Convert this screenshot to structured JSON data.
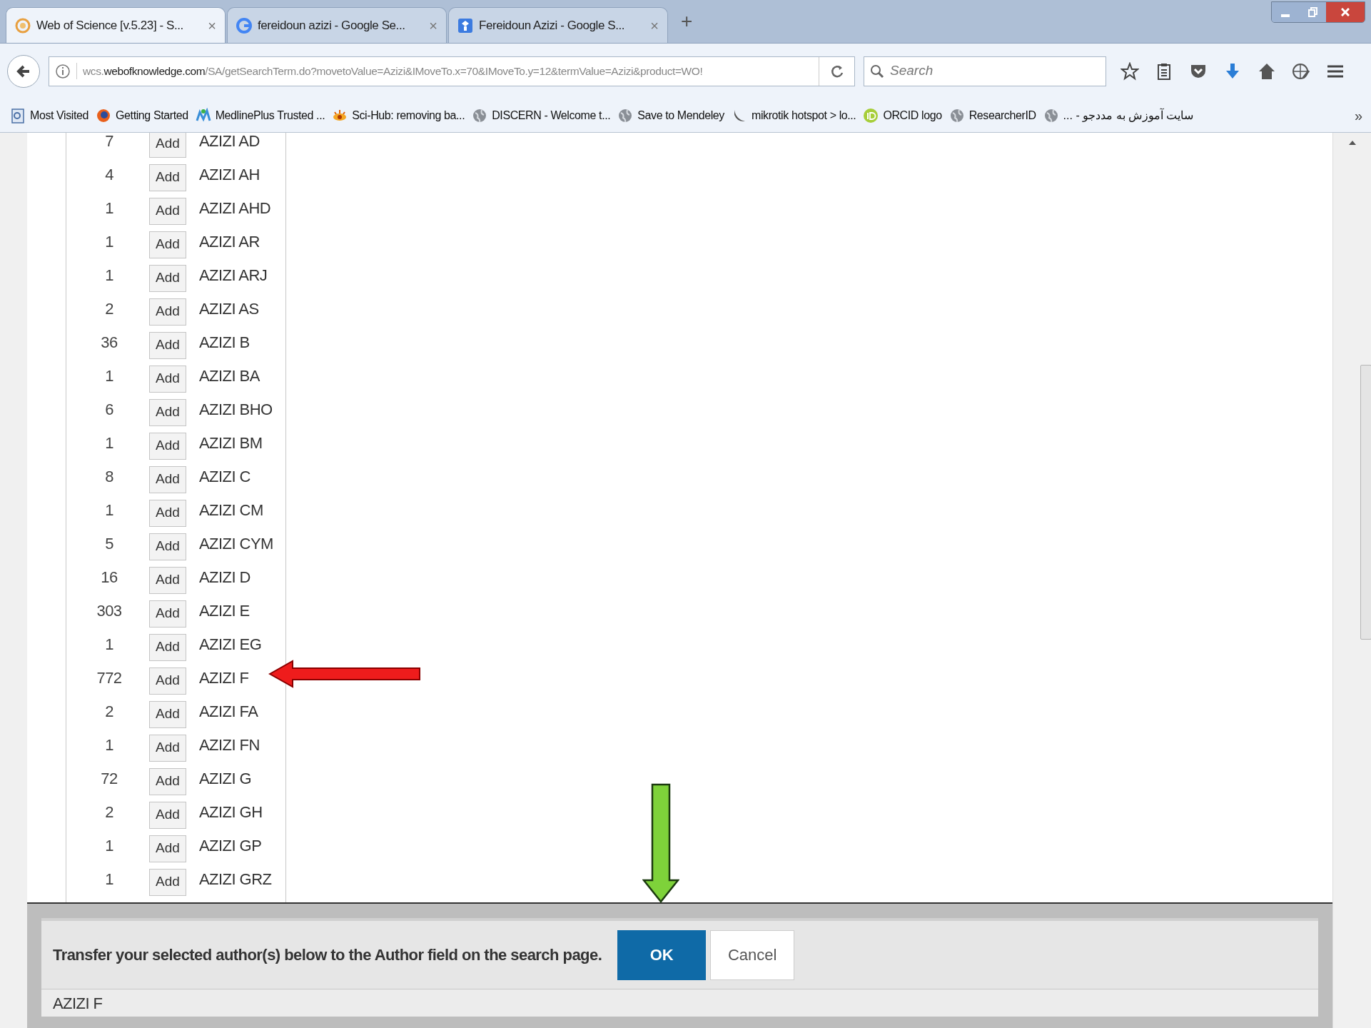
{
  "tabs": [
    {
      "kind": "wos",
      "label": "Web of Science [v.5.23] - S...",
      "close": "×",
      "selected": true
    },
    {
      "kind": "google",
      "label": "fereidoun azizi - Google Se...",
      "close": "×",
      "selected": false
    },
    {
      "kind": "scholar",
      "label": "Fereidoun Azizi - Google S...",
      "close": "×",
      "selected": false
    }
  ],
  "new_tab": "+",
  "url": {
    "prefix": "wcs.",
    "domain": "webofknowledge.com",
    "path": "/SA/getSearchTerm.do?movetoValue=Azizi&IMoveTo.x=70&IMoveTo.y=12&termValue=Azizi&product=WO!"
  },
  "search": {
    "placeholder": "Search"
  },
  "bookmarks": [
    {
      "kind": "mostvisited",
      "label": "Most Visited"
    },
    {
      "kind": "firefox",
      "label": "Getting Started"
    },
    {
      "kind": "medline",
      "label": "MedlinePlus Trusted ..."
    },
    {
      "kind": "scihub",
      "label": "Sci-Hub: removing ba..."
    },
    {
      "kind": "globe",
      "label": "DISCERN - Welcome t..."
    },
    {
      "kind": "globe",
      "label": "Save to Mendeley"
    },
    {
      "kind": "mikrotik",
      "label": "mikrotik hotspot > lo..."
    },
    {
      "kind": "orcid",
      "label": "ORCID logo"
    },
    {
      "kind": "globe",
      "label": "ResearcherID"
    },
    {
      "kind": "globe",
      "label": "... - سایت آموزش به مددجو"
    }
  ],
  "more": "»",
  "rows": [
    {
      "count": "7",
      "button": "Add",
      "author": "AZIZI AD"
    },
    {
      "count": "4",
      "button": "Add",
      "author": "AZIZI AH"
    },
    {
      "count": "1",
      "button": "Add",
      "author": "AZIZI AHD"
    },
    {
      "count": "1",
      "button": "Add",
      "author": "AZIZI AR"
    },
    {
      "count": "1",
      "button": "Add",
      "author": "AZIZI ARJ"
    },
    {
      "count": "2",
      "button": "Add",
      "author": "AZIZI AS"
    },
    {
      "count": "36",
      "button": "Add",
      "author": "AZIZI B"
    },
    {
      "count": "1",
      "button": "Add",
      "author": "AZIZI BA"
    },
    {
      "count": "6",
      "button": "Add",
      "author": "AZIZI BHO"
    },
    {
      "count": "1",
      "button": "Add",
      "author": "AZIZI BM"
    },
    {
      "count": "8",
      "button": "Add",
      "author": "AZIZI C"
    },
    {
      "count": "1",
      "button": "Add",
      "author": "AZIZI CM"
    },
    {
      "count": "5",
      "button": "Add",
      "author": "AZIZI CYM"
    },
    {
      "count": "16",
      "button": "Add",
      "author": "AZIZI D"
    },
    {
      "count": "303",
      "button": "Add",
      "author": "AZIZI E"
    },
    {
      "count": "1",
      "button": "Add",
      "author": "AZIZI EG"
    },
    {
      "count": "772",
      "button": "Add",
      "author": "AZIZI F"
    },
    {
      "count": "2",
      "button": "Add",
      "author": "AZIZI FA"
    },
    {
      "count": "1",
      "button": "Add",
      "author": "AZIZI FN"
    },
    {
      "count": "72",
      "button": "Add",
      "author": "AZIZI G"
    },
    {
      "count": "2",
      "button": "Add",
      "author": "AZIZI GH"
    },
    {
      "count": "1",
      "button": "Add",
      "author": "AZIZI GP"
    },
    {
      "count": "1",
      "button": "Add",
      "author": "AZIZI GRZ"
    }
  ],
  "transfer": {
    "message": "Transfer your selected author(s) below to the Author field on the search page.",
    "ok": "OK",
    "cancel": "Cancel",
    "selected_authors": "AZIZI F"
  }
}
